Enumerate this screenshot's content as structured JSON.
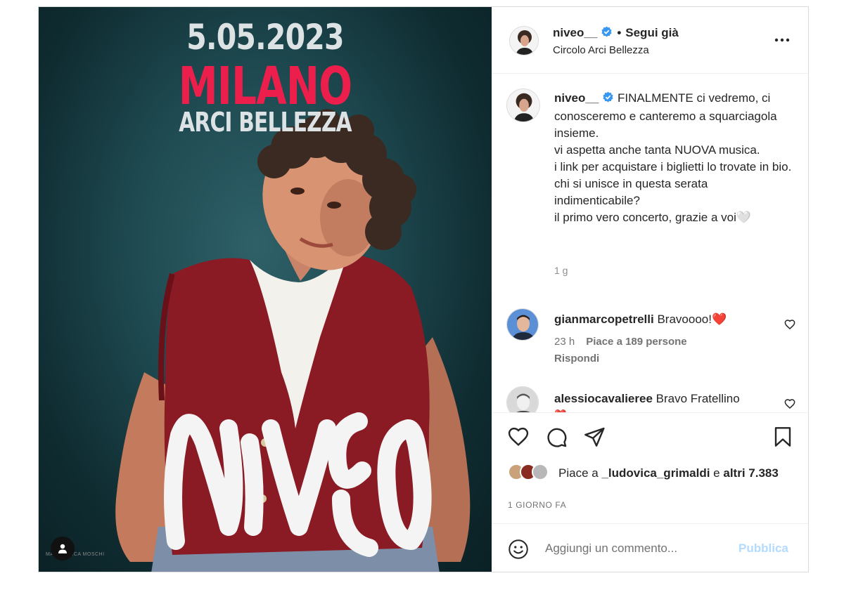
{
  "poster": {
    "date": "5.05.2023",
    "city": "MILANO",
    "venue": "ARCI BELLEZZA",
    "artist_logo": "NIVEO",
    "credit": "MARCO MICA MOSCHI",
    "colors": {
      "accent": "#ec1e4c",
      "background": "#1e4950",
      "vest": "#8a1a24"
    }
  },
  "header": {
    "username": "niveo__",
    "separator": "•",
    "follow_label": "Segui già",
    "location": "Circolo Arci Bellezza",
    "more_icon": "more-horizontal-icon"
  },
  "caption": {
    "username": "niveo__",
    "text": "FINALMENTE ci vedremo, ci conosceremo e canteremo a squarciagola insieme.\nvi aspetta anche tanta NUOVA musica.\ni link per acquistare i biglietti lo trovate in bio.\nchi si unisce in questa serata indimenticabile?\nil primo vero concerto, grazie a voi🤍",
    "time": "1 g"
  },
  "comments": [
    {
      "username": "gianmarcopetrelli",
      "text": "Bravoooo!❤️",
      "time": "23 h",
      "likes": "Piace a 189 persone",
      "reply": "Rispondi"
    },
    {
      "username": "alessiocavalieree",
      "text": "Bravo Fratellino",
      "extra": "❤️"
    }
  ],
  "actions": {
    "like_icon": "heart-icon",
    "comment_icon": "comment-icon",
    "share_icon": "send-icon",
    "save_icon": "bookmark-icon",
    "likes_prefix": "Piace a",
    "likes_user": "_ludovica_grimaldi",
    "likes_and": "e",
    "likes_others": "altri 7.383",
    "time_ago": "1 GIORNO FA"
  },
  "composer": {
    "placeholder": "Aggiungi un commento...",
    "publish_label": "Pubblica",
    "publish_color": "#b3dbff"
  }
}
